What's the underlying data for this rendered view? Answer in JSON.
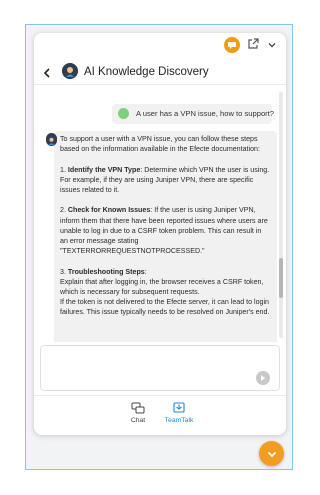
{
  "window": {
    "icons": {
      "brand": "chat-bubble-icon",
      "popout": "open-external-icon",
      "collapse": "chevron-down-icon"
    }
  },
  "header": {
    "title": "AI Knowledge Discovery",
    "back_icon": "chevron-left-icon"
  },
  "conversation": {
    "user_message": "A user has a VPN issue, how to support?",
    "bot_message": {
      "intro": "To support a user with a VPN issue, you can follow these steps based on the information available in the Efecte documentation:",
      "step1_title": "Identify the VPN Type",
      "step1_text": ": Determine which VPN the user is using. For example, if they are using Juniper VPN, there are specific issues related to it.",
      "step1_prefix": "1. ",
      "step2_prefix": "2. ",
      "step2_title": "Check for Known Issues",
      "step2_text": ": If the user is using Juniper VPN, inform them that there have been reported issues where users are unable to log in due to a CSRF token problem. This can result in an error message stating \"TEXTERRORREQUESTNOTPROCESSED.\"",
      "step3_prefix": "3. ",
      "step3_title": "Troubleshooting Steps",
      "step3_colon": ":",
      "step3_text1": "Explain that after logging in, the browser receives a CSRF token, which is necessary for subsequent requests.",
      "step3_text2": "If the token is not delivered to the Efecte server, it can lead to login failures. This issue typically needs to be resolved on Juniper's end."
    }
  },
  "input": {
    "placeholder": "",
    "send_icon": "send-arrow-icon"
  },
  "bottom_nav": {
    "items": [
      {
        "label": "Chat",
        "icon": "chat-icon",
        "active": false
      },
      {
        "label": "TeamTalk",
        "icon": "teamtalk-icon",
        "active": true
      }
    ]
  },
  "fab": {
    "icon": "chevron-down-icon"
  },
  "colors": {
    "accent": "#f39c22",
    "active_nav": "#1f87d6",
    "border": "#7ec9e3"
  }
}
